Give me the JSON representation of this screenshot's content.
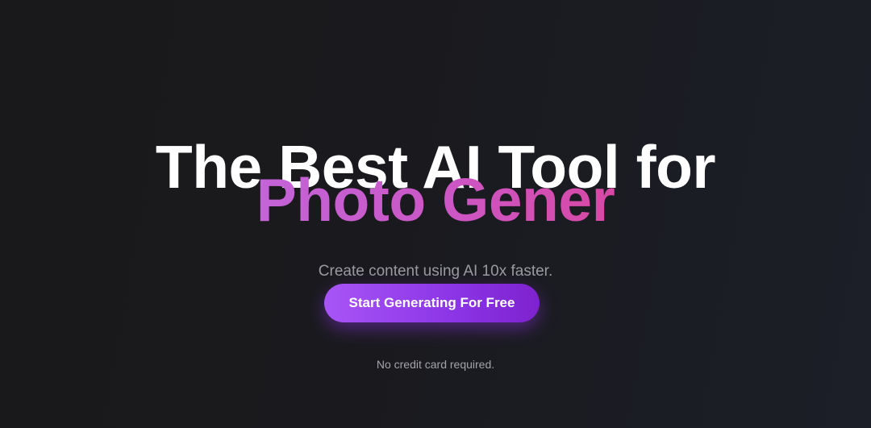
{
  "hero": {
    "headline_line1": "The Best AI Tool for",
    "headline_line2": "Photo Gener",
    "subtitle": "Create content using AI 10x faster.",
    "cta_label": "Start Generating For Free",
    "note": "No credit card required."
  },
  "colors": {
    "background": "#19191b",
    "headline": "#ffffff",
    "gradient_start": "#c364d8",
    "gradient_end": "#d848a4",
    "button_start": "#a855f7",
    "button_end": "#7e22ce",
    "muted_text": "#9a9aa1"
  }
}
